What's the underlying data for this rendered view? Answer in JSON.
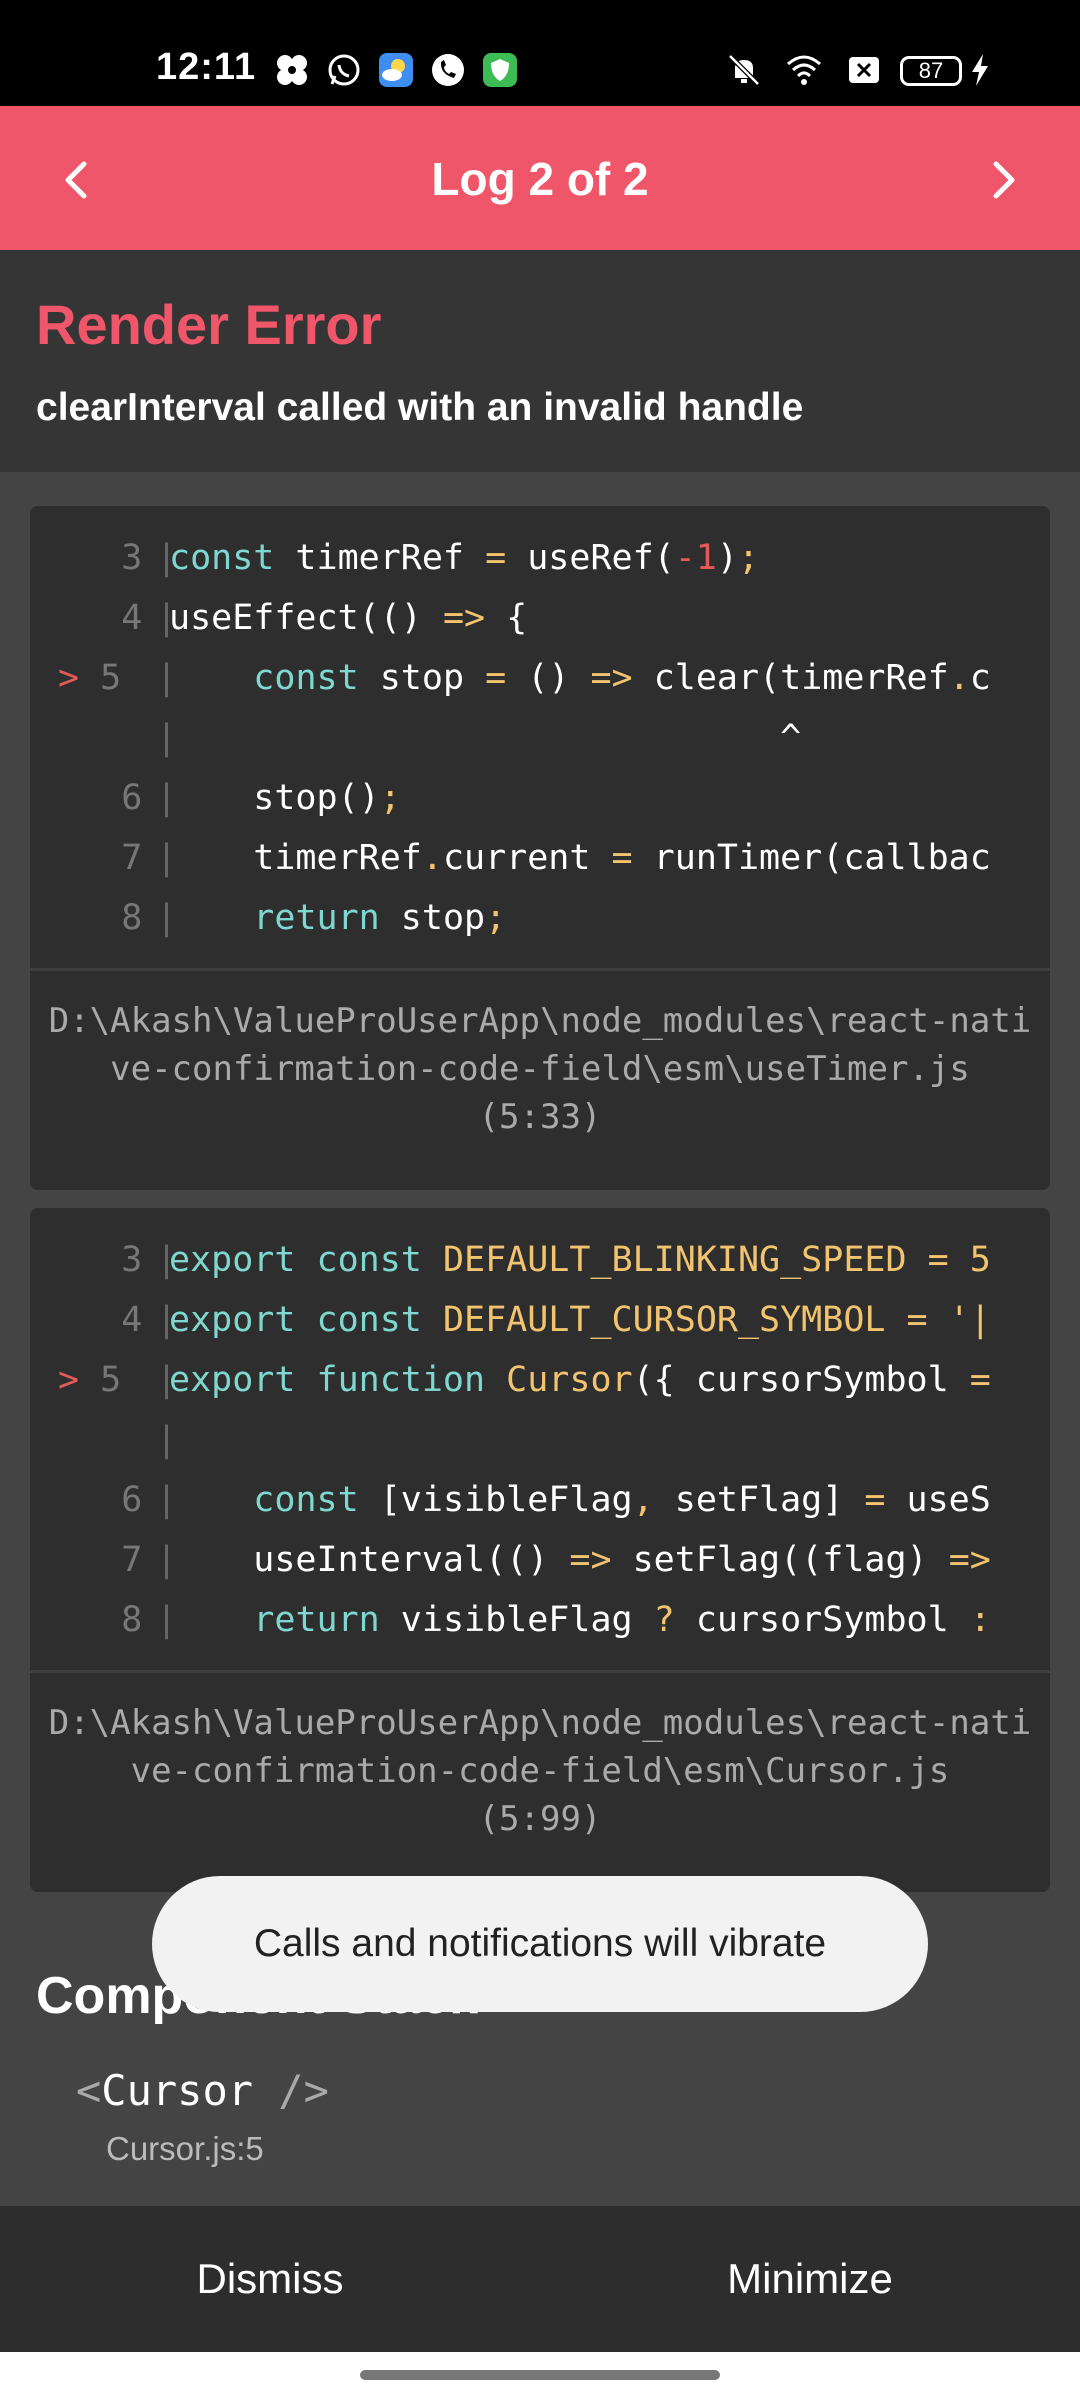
{
  "status_bar": {
    "time": "12:11",
    "battery": "87",
    "icons": [
      "pinwheel-icon",
      "whatsapp-icon",
      "weather-icon",
      "phone-icon",
      "shield-icon",
      "mute-icon",
      "wifi-icon",
      "no-sim-icon",
      "battery-icon",
      "charging-icon"
    ]
  },
  "header": {
    "title": "Log 2 of 2",
    "prev_icon": "chevron-left-icon",
    "next_icon": "chevron-right-icon"
  },
  "error": {
    "title": "Render Error",
    "message": "clearInterval called with an invalid handle"
  },
  "code_frames": [
    {
      "lines": [
        {
          "num": "3",
          "active": false,
          "text": "const timerRef = useRef(-1);"
        },
        {
          "num": "4",
          "active": false,
          "text": "useEffect(() => {"
        },
        {
          "num": "5",
          "active": true,
          "text": "    const stop = () => clear(timerRef.c"
        },
        {
          "num": "",
          "active": false,
          "text": "                             ^"
        },
        {
          "num": "6",
          "active": false,
          "text": "    stop();"
        },
        {
          "num": "7",
          "active": false,
          "text": "    timerRef.current = runTimer(callbac"
        },
        {
          "num": "8",
          "active": false,
          "text": "    return stop;"
        }
      ],
      "path": "D:\\Akash\\ValueProUserApp\\node_modules\\react-native-confirmation-code-field\\esm\\useTimer.js",
      "location": "(5:33)"
    },
    {
      "lines": [
        {
          "num": "3",
          "active": false,
          "text": "export const DEFAULT_BLINKING_SPEED = 5"
        },
        {
          "num": "4",
          "active": false,
          "text": "export const DEFAULT_CURSOR_SYMBOL = '|"
        },
        {
          "num": "5",
          "active": true,
          "text": "export function Cursor({ cursorSymbol ="
        },
        {
          "num": "",
          "active": false,
          "text": ""
        },
        {
          "num": "6",
          "active": false,
          "text": "    const [visibleFlag, setFlag] = useS"
        },
        {
          "num": "7",
          "active": false,
          "text": "    useInterval(() => setFlag((flag) =>"
        },
        {
          "num": "8",
          "active": false,
          "text": "    return visibleFlag ? cursorSymbol :"
        }
      ],
      "path": "D:\\Akash\\ValueProUserApp\\node_modules\\react-native-confirmation-code-field\\esm\\Cursor.js",
      "location": "(5:99)"
    }
  ],
  "component_stack": {
    "title": "Component Stack",
    "open": "<",
    "name": "Cursor",
    "close": " />",
    "file": "Cursor.js:5"
  },
  "toast": {
    "message": "Calls and notifications will vibrate"
  },
  "footer": {
    "dismiss": "Dismiss",
    "minimize": "Minimize"
  },
  "colors": {
    "accent": "#f0566a",
    "keyword": "#7fd8d0",
    "operator": "#f2c46f",
    "number": "#e35a5a",
    "background": "#444444"
  }
}
